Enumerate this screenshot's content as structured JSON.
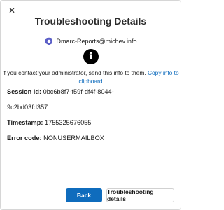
{
  "dialog": {
    "close_glyph": "✕",
    "title": "Troubleshooting Details",
    "account": {
      "email": "Dmarc-Reports@michev.info",
      "icon": "account-org-icon"
    },
    "info_icon_glyph": "i",
    "instructions": "If you contact your administrator, send this info to them.",
    "copy_link": "Copy info to clipboard",
    "details": {
      "session_label": "Session Id:",
      "session_value_1": "0bc6b8f7-f59f-df4f-8044-",
      "session_value_2": "9c2bd03fd357",
      "timestamp_label": "Timestamp:",
      "timestamp_value": "1755325676055",
      "error_label": "Error code:",
      "error_value": "NONUSERMAILBOX"
    },
    "buttons": {
      "back": "Back",
      "troubleshooting": "Troubleshooting details"
    },
    "colors": {
      "accent": "#0f6cbd",
      "icon_bg": "#000000"
    }
  }
}
